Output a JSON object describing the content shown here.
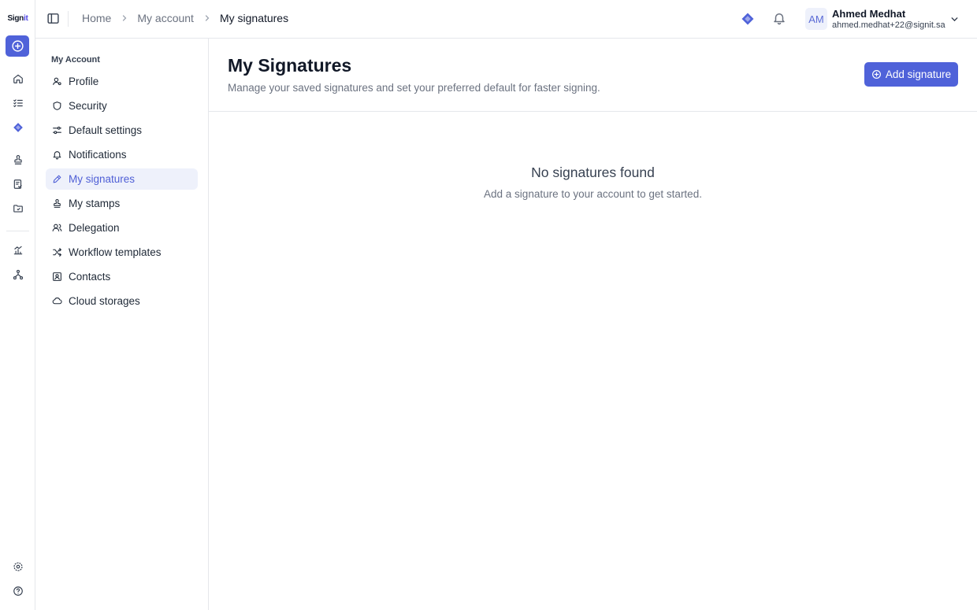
{
  "app": {
    "logo_text": "Sign",
    "logo_accent": "it",
    "accent_color": "#4f62d9"
  },
  "breadcrumb": [
    "Home",
    "My account",
    "My signatures"
  ],
  "user": {
    "initials": "AM",
    "name": "Ahmed Medhat",
    "email": "ahmed.medhat+22@signit.sa"
  },
  "rail": {
    "icons": [
      "plus-circle-icon",
      "home-icon",
      "tasks-icon",
      "premium-diamond-icon",
      "stamp-icon",
      "document-check-icon",
      "folder-check-icon",
      "chart-icon",
      "workflow-icon",
      "settings-icon",
      "help-icon"
    ]
  },
  "account_nav": {
    "title": "My Account",
    "items": [
      {
        "label": "Profile",
        "icon": "user-icon",
        "active": false
      },
      {
        "label": "Security",
        "icon": "shield-icon",
        "active": false
      },
      {
        "label": "Default settings",
        "icon": "toggles-icon",
        "active": false
      },
      {
        "label": "Notifications",
        "icon": "bell-icon",
        "active": false
      },
      {
        "label": "My signatures",
        "icon": "pen-icon",
        "active": true
      },
      {
        "label": "My stamps",
        "icon": "stamp-icon",
        "active": false
      },
      {
        "label": "Delegation",
        "icon": "users-icon",
        "active": false
      },
      {
        "label": "Workflow templates",
        "icon": "shuffle-icon",
        "active": false
      },
      {
        "label": "Contacts",
        "icon": "contact-icon",
        "active": false
      },
      {
        "label": "Cloud storages",
        "icon": "cloud-icon",
        "active": false
      }
    ]
  },
  "page": {
    "title": "My Signatures",
    "subtitle": "Manage your saved signatures and set your preferred default for faster signing.",
    "add_button": "Add signature",
    "empty_title": "No signatures found",
    "empty_text": "Add a signature to your account to get started."
  }
}
